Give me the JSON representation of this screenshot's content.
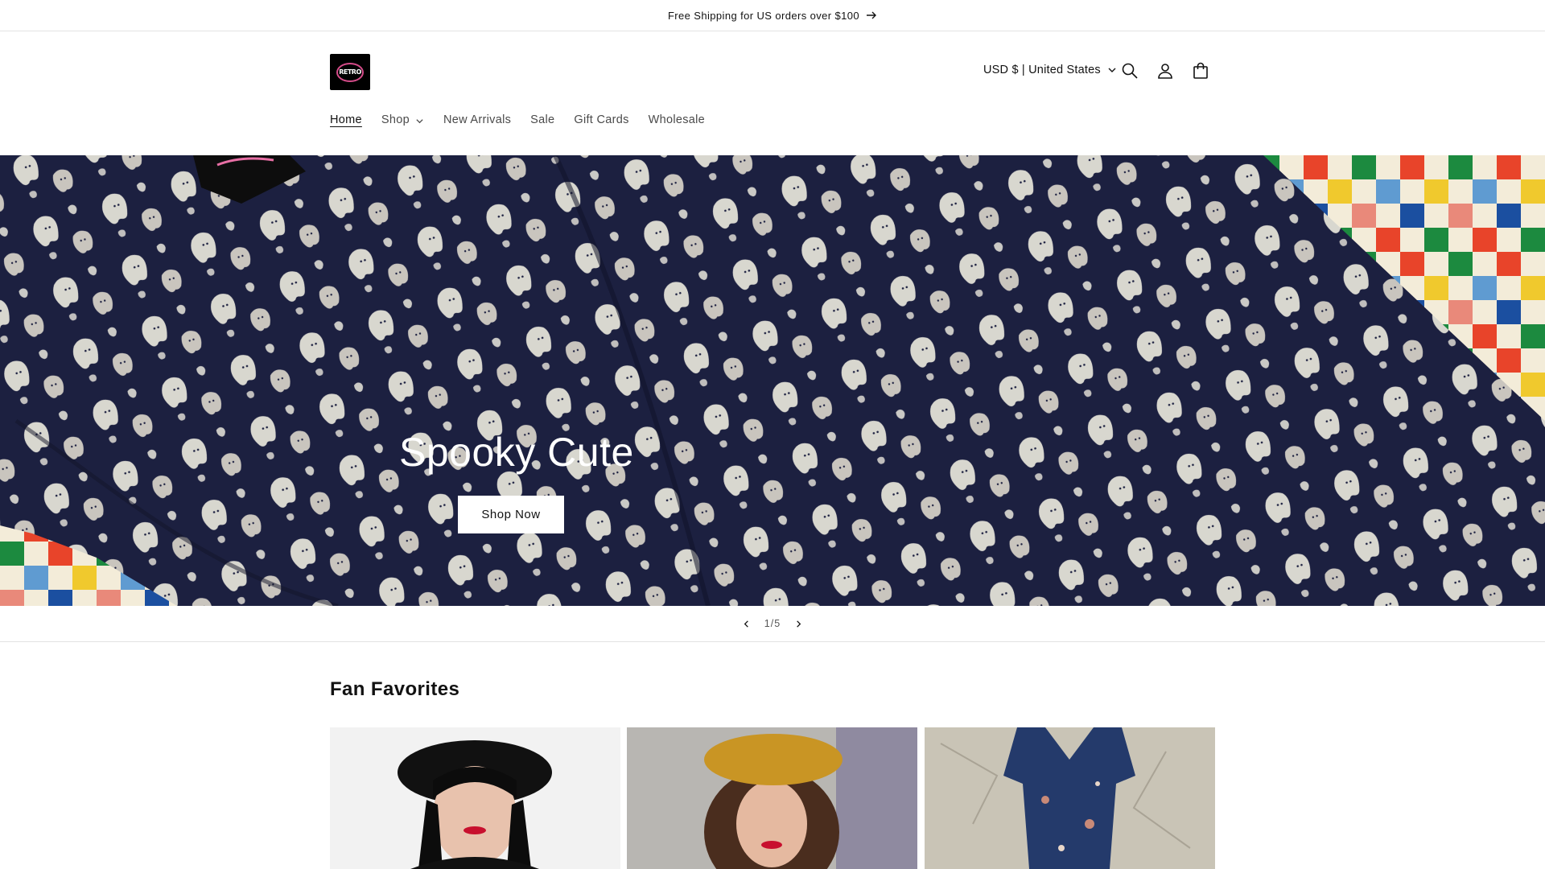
{
  "announcement": {
    "text": "Free Shipping for US orders over $100",
    "icon": "arrow-right-icon"
  },
  "header": {
    "logo_text": "RETRO",
    "country_selector": "USD $ | United States",
    "icons": [
      "search-icon",
      "account-icon",
      "cart-icon"
    ]
  },
  "nav": {
    "items": [
      {
        "label": "Home",
        "active": true
      },
      {
        "label": "Shop",
        "has_dropdown": true
      },
      {
        "label": "New Arrivals"
      },
      {
        "label": "Sale"
      },
      {
        "label": "Gift Cards"
      },
      {
        "label": "Wholesale"
      }
    ]
  },
  "hero": {
    "title": "Spooky Cute",
    "button_label": "Shop Now"
  },
  "slider": {
    "counter": "1/5",
    "prev_icon": "chevron-left-icon",
    "next_icon": "chevron-right-icon"
  },
  "collection": {
    "title": "Fan Favorites"
  },
  "colors": {
    "background": "#ffffff",
    "text": "#121212",
    "hero_fabric": "#1f2340",
    "button_bg": "#ffffff"
  }
}
